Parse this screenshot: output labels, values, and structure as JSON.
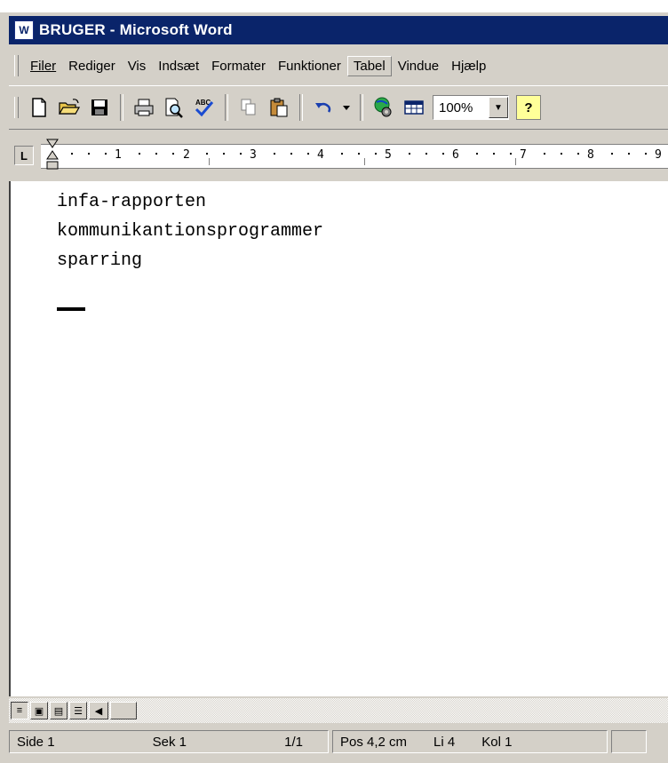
{
  "window": {
    "title": "BRUGER - Microsoft Word",
    "app_icon_label": "W"
  },
  "menu": {
    "items": [
      "Filer",
      "Rediger",
      "Vis",
      "Indsæt",
      "Formater",
      "Funktioner",
      "Tabel",
      "Vindue",
      "Hjælp"
    ],
    "active_item": "Tabel"
  },
  "toolbar": {
    "buttons": [
      "new-document-icon",
      "open-folder-icon",
      "save-disk-icon",
      "print-icon",
      "print-preview-icon",
      "spelling-check-icon",
      "copy-icon",
      "paste-icon",
      "undo-icon",
      "undo-dropdown-icon",
      "web-globe-icon",
      "insert-table-icon"
    ],
    "spell_badge": "ABC",
    "zoom_value": "100%",
    "help_label": "?"
  },
  "ruler": {
    "tab_selector": "L",
    "numbers": [
      "1",
      "2",
      "3",
      "4",
      "5",
      "6",
      "7",
      "8",
      "9"
    ]
  },
  "document": {
    "lines": [
      "infa-rapporten",
      "kommunikantionsprogrammer",
      "sparring"
    ]
  },
  "statusbar": {
    "page": "Side 1",
    "section": "Sek 1",
    "page_of": "1/1",
    "position": "Pos 4,2 cm",
    "line": "Li 4",
    "column": "Kol 1"
  },
  "colors": {
    "title_bar": "#0a246a",
    "chrome": "#d4d0c8",
    "document_bg": "#ffffff"
  }
}
